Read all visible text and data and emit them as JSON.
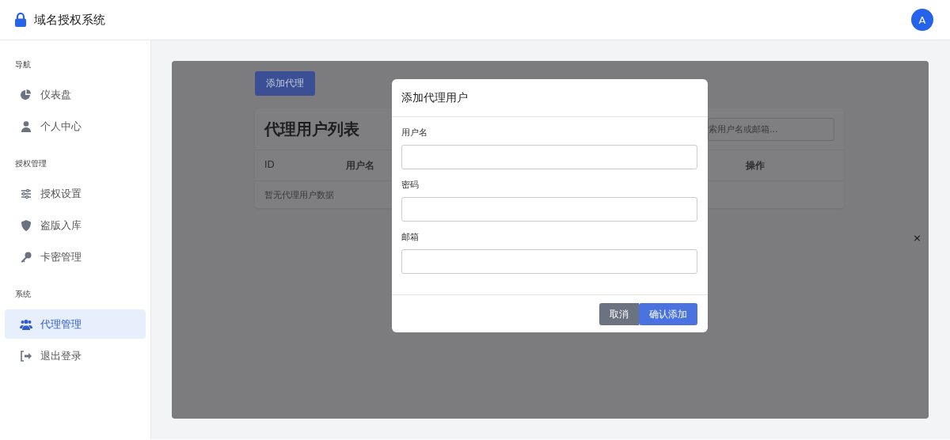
{
  "header": {
    "title": "域名授权系统",
    "avatar": "A"
  },
  "sidebar": {
    "sections": [
      {
        "label": "导航",
        "items": [
          {
            "label": "仪表盘",
            "kind": "chart",
            "selected": false
          },
          {
            "label": "个人中心",
            "kind": "user",
            "selected": false
          }
        ]
      },
      {
        "label": "授权管理",
        "items": [
          {
            "label": "授权设置",
            "kind": "sliders",
            "selected": false
          },
          {
            "label": "盗版入库",
            "kind": "shield",
            "selected": false
          },
          {
            "label": "卡密管理",
            "kind": "key",
            "selected": false
          }
        ]
      },
      {
        "label": "系统",
        "items": [
          {
            "label": "代理管理",
            "kind": "users",
            "selected": true
          },
          {
            "label": "退出登录",
            "kind": "logout",
            "selected": false
          }
        ]
      }
    ]
  },
  "page": {
    "add_button": "添加代理",
    "card_title": "代理用户列表",
    "search": {
      "placeholder": "索用户名或邮箱..."
    },
    "columns": [
      {
        "label": "ID",
        "bold": false
      },
      {
        "label": "用户名",
        "bold": true
      },
      {
        "label": "操作",
        "bold": true
      }
    ],
    "empty_text": "暂无代理用户数据",
    "close": "×"
  },
  "modal": {
    "title": "添加代理用户",
    "fields": [
      {
        "label": "用户名"
      },
      {
        "label": "密码"
      },
      {
        "label": "邮箱"
      }
    ],
    "cancel": "取消",
    "confirm": "确认添加"
  }
}
